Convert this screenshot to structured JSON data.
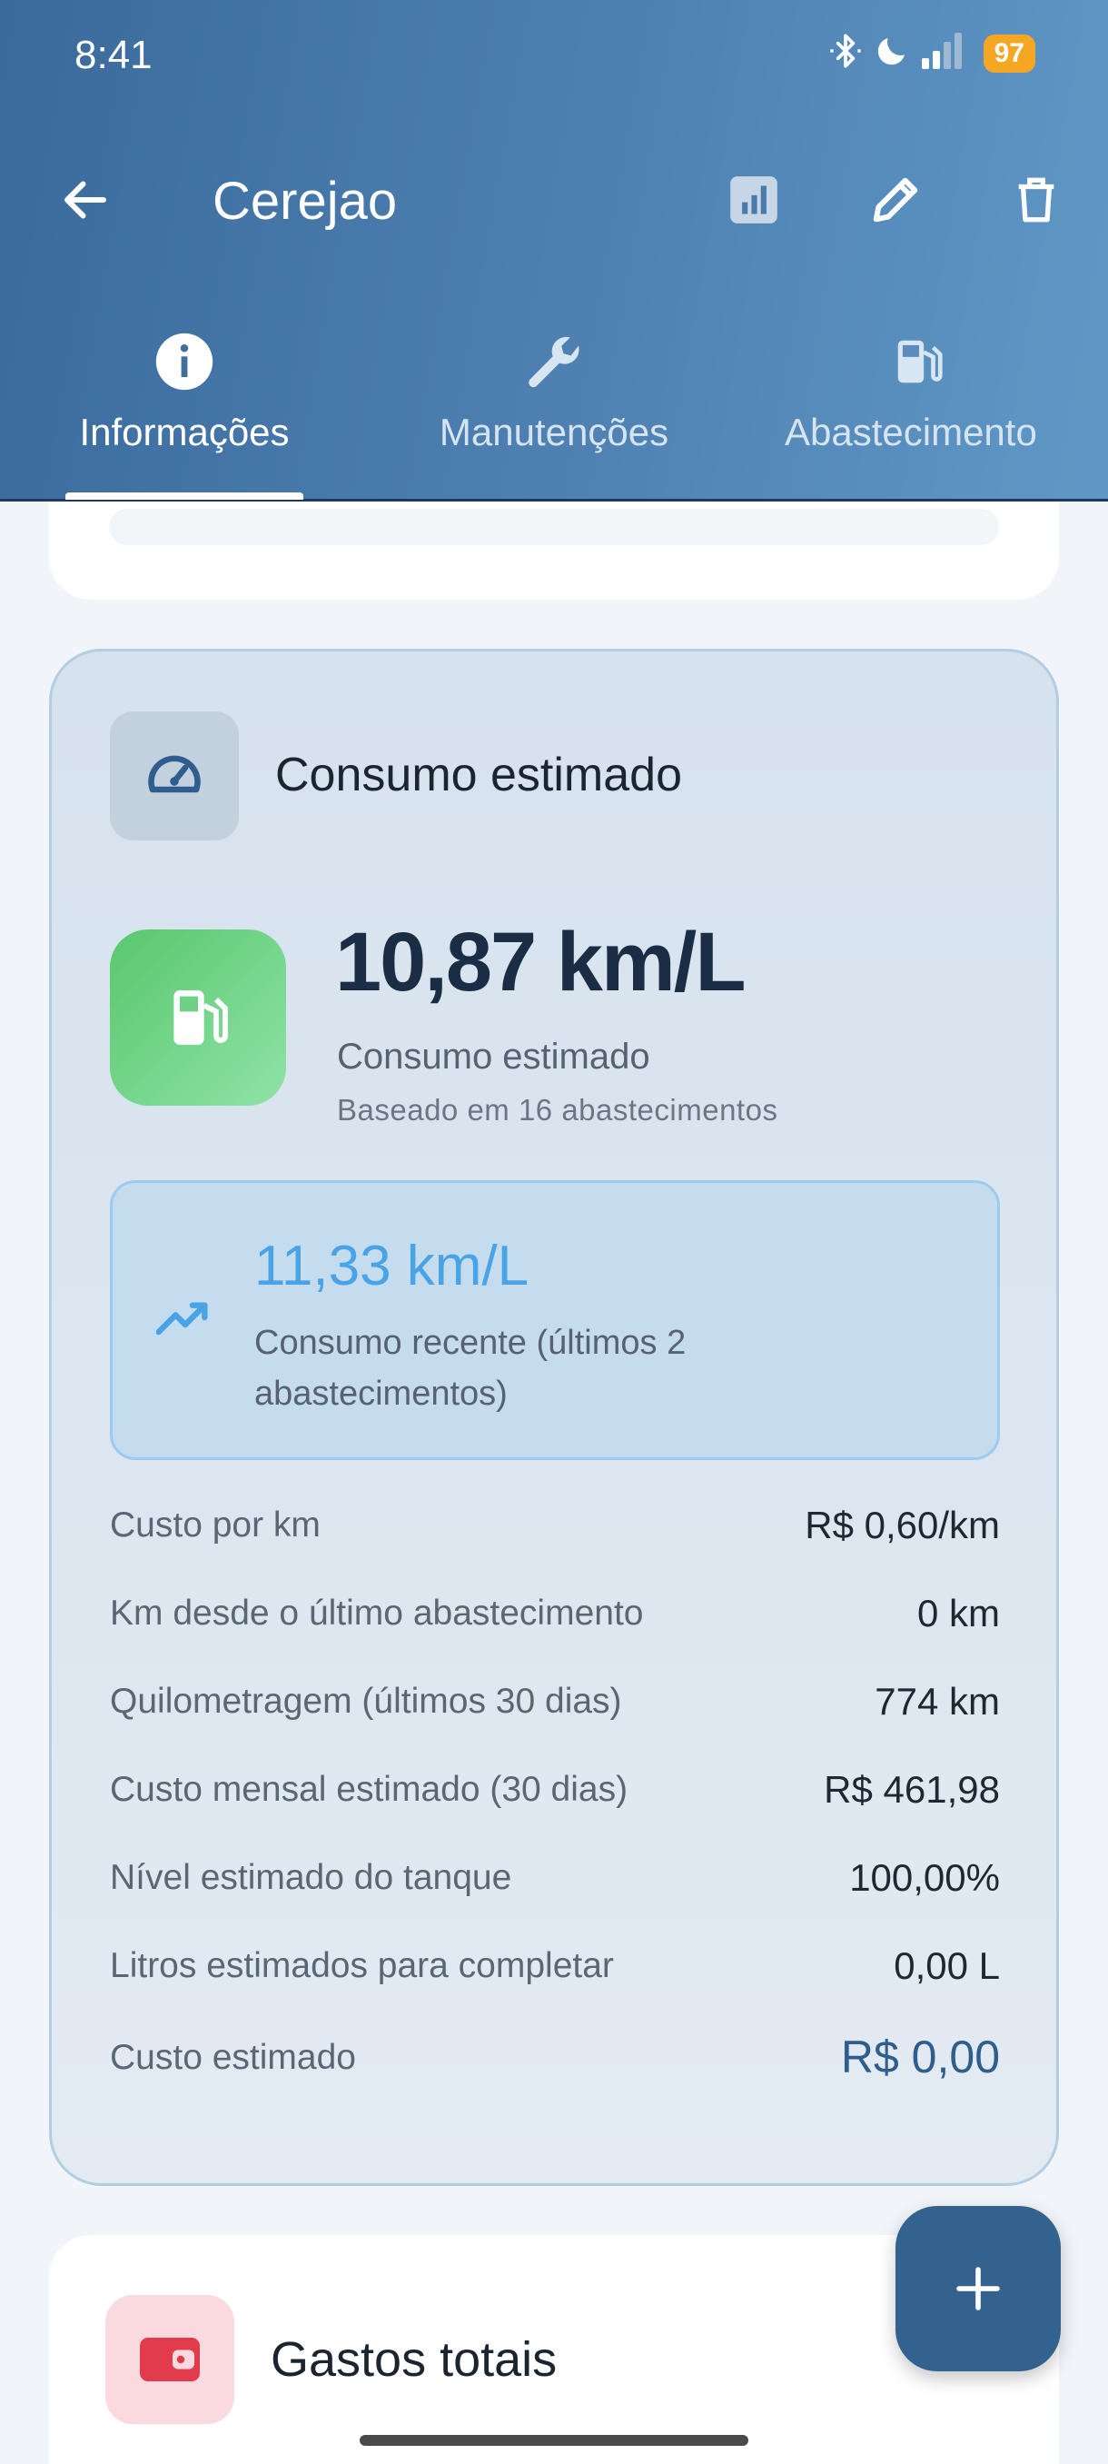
{
  "status_bar": {
    "time": "8:41",
    "battery": "97"
  },
  "app_bar": {
    "title": "Cerejao"
  },
  "tabs": [
    {
      "label": "Informações",
      "active": true
    },
    {
      "label": "Manutenções",
      "active": false
    },
    {
      "label": "Abastecimento",
      "active": false
    }
  ],
  "consumo": {
    "title": "Consumo estimado",
    "value": "10,87 km/L",
    "label": "Consumo estimado",
    "sub": "Baseado em 16 abastecimentos",
    "recent_value": "11,33 km/L",
    "recent_label": "Consumo recente (últimos 2 abastecimentos)",
    "rows": [
      {
        "label": "Custo por km",
        "value": "R$ 0,60/km"
      },
      {
        "label": "Km desde o último abastecimento",
        "value": "0 km"
      },
      {
        "label": "Quilometragem (últimos 30 dias)",
        "value": "774 km"
      },
      {
        "label": "Custo mensal estimado (30 dias)",
        "value": "R$ 461,98"
      },
      {
        "label": "Nível estimado do tanque",
        "value": "100,00%"
      },
      {
        "label": "Litros estimados para completar",
        "value": "0,00 L"
      },
      {
        "label": "Custo estimado",
        "value": "R$ 0,00"
      }
    ]
  },
  "gastos": {
    "title": "Gastos totais"
  },
  "colors": {
    "header_start": "#3a6a9c",
    "header_end": "#5f98c6",
    "accent_blue": "#4aa3e6",
    "fuel_green": "#59c76e",
    "fab": "#33628f",
    "battery": "#f5a623"
  }
}
